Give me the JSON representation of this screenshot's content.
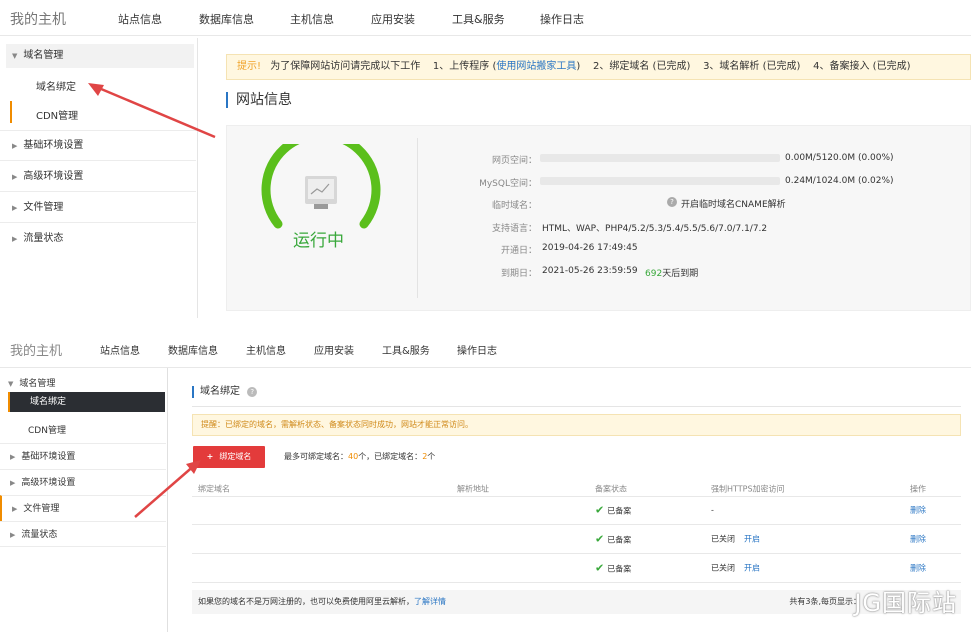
{
  "colors": {
    "accent": "#2a76c4",
    "red_button": "#e33b3b",
    "green": "#39a83b",
    "warning_bg": "#fff7e0",
    "orange": "#f08c00",
    "arrow": "#e04545"
  },
  "top": {
    "brand": "我的主机",
    "nav": [
      "站点信息",
      "数据库信息",
      "主机信息",
      "应用安装",
      "工具&服务",
      "操作日志"
    ],
    "sidebar": {
      "group_domain": "域名管理",
      "sub_binding": "域名绑定",
      "sub_cdn": "CDN管理",
      "rows": [
        "基础环境设置",
        "高级环境设置",
        "文件管理",
        "流量状态"
      ]
    },
    "tip": {
      "label": "提示!",
      "text1": "为了保障网站访问请完成以下工作",
      "step1": "1、上传程序 (",
      "step1_link": "使用网站搬家工具",
      "step1_end": ")",
      "step2": "2、绑定域名 (已完成)",
      "step3": "3、域名解析 (已完成)",
      "step4": "4、备案接入 (已完成)"
    },
    "section_title": "网站信息",
    "status": "运行中",
    "status_progress": 0.75,
    "info": {
      "web_space_label": "网页空间：",
      "web_space_value": "0.00M/5120.0M (0.00%)",
      "mysql_label": "MySQL空间：",
      "mysql_value": "0.24M/1024.0M (0.02%)",
      "tempdomain_label": "临时域名：",
      "tempdomain_link": "开启临时域名CNAME解析",
      "lang_label": "支持语言：",
      "lang_value": "HTML、WAP、PHP4/5.2/5.3/5.4/5.5/5.6/7.0/7.1/7.2",
      "open_label": "开通日：",
      "open_value": "2019-04-26 17:49:45",
      "expire_label": "到期日：",
      "expire_value": "2021-05-26 23:59:59",
      "days_num": "692",
      "days_text": "天后到期"
    }
  },
  "bottom": {
    "brand": "我的主机",
    "nav": [
      "站点信息",
      "数据库信息",
      "主机信息",
      "应用安装",
      "工具&服务",
      "操作日志"
    ],
    "sidebar": {
      "group_domain": "域名管理",
      "active": "域名绑定",
      "sub_cdn": "CDN管理",
      "rows": [
        "基础环境设置",
        "高级环境设置",
        "文件管理",
        "流量状态"
      ]
    },
    "title": "域名绑定",
    "title_help_icon": "?",
    "warning": "提醒：已绑定的域名，需解析状态、备案状态同时成功，网站才能正常访问。",
    "add_button": "绑定域名",
    "add_plus": "+",
    "quota_prefix": "最多可绑定域名：",
    "quota_max": "40",
    "quota_mid": "个，已绑定域名：",
    "quota_bound": "2",
    "quota_suffix": "个",
    "columns": [
      "绑定域名",
      "解析地址",
      "备案状态",
      "强制HTTPS加密访问",
      "操作"
    ],
    "rows": [
      {
        "beian": "已备案",
        "https": "-",
        "https_action": "",
        "op": "删除"
      },
      {
        "beian": "已备案",
        "https": "已关闭",
        "https_action": "开启",
        "op": "删除"
      },
      {
        "beian": "已备案",
        "https": "已关闭",
        "https_action": "开启",
        "op": "删除"
      }
    ],
    "footer_text": "如果您的域名不是万网注册的，也可以免费使用阿里云解析，",
    "footer_link": "了解详情",
    "pager": "共有3条,每页显示：",
    "watermark": "JG国际站"
  }
}
